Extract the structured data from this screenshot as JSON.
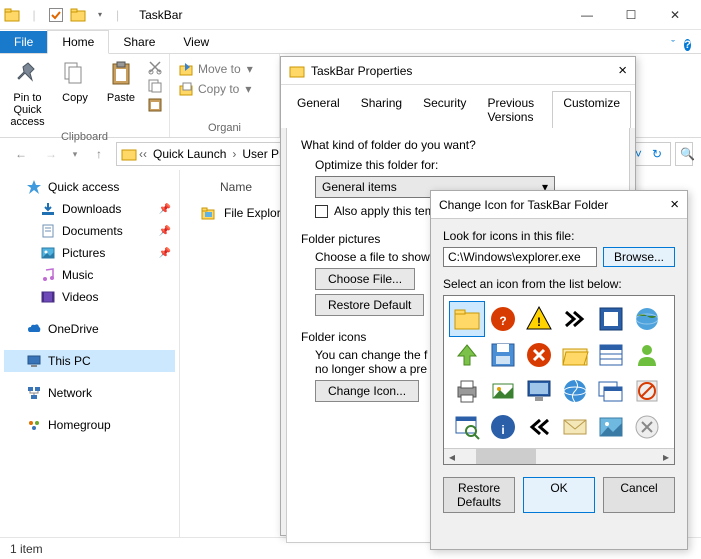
{
  "titlebar": {
    "title": "TaskBar"
  },
  "win_controls": {
    "min": "—",
    "max": "☐",
    "close": "✕"
  },
  "tabs": {
    "file": "File",
    "home": "Home",
    "share": "Share",
    "view": "View"
  },
  "ribbon": {
    "pin": "Pin to Quick\naccess",
    "copy": "Copy",
    "paste": "Paste",
    "clipboard_group": "Clipboard",
    "moveto": "Move to",
    "copyto": "Copy to",
    "organize_group": "Organi"
  },
  "breadcrumb": {
    "seg1": "Quick Launch",
    "seg2": "User Pi"
  },
  "nav": {
    "quick": "Quick access",
    "downloads": "Downloads",
    "documents": "Documents",
    "pictures": "Pictures",
    "music": "Music",
    "videos": "Videos",
    "onedrive": "OneDrive",
    "thispc": "This PC",
    "network": "Network",
    "homegroup": "Homegroup"
  },
  "content": {
    "header": "Name",
    "item1": "File Explorer"
  },
  "status": {
    "count": "1 item"
  },
  "props": {
    "title": "TaskBar Properties",
    "tabs": {
      "general": "General",
      "sharing": "Sharing",
      "security": "Security",
      "prev": "Previous Versions",
      "customize": "Customize"
    },
    "q1": "What kind of folder do you want?",
    "optimize": "Optimize this folder for:",
    "combo_val": "General items",
    "also_apply": "Also apply this tem",
    "pictures_sect": "Folder pictures",
    "choose_desc": "Choose a file to show",
    "choose_btn": "Choose File...",
    "restore_btn": "Restore Default",
    "icons_sect": "Folder icons",
    "icons_desc1": "You can change the f",
    "icons_desc2": "no longer show a pre",
    "change_icon": "Change Icon..."
  },
  "chicon": {
    "title": "Change Icon for TaskBar Folder",
    "look_label": "Look for icons in this file:",
    "path": "C:\\Windows\\explorer.exe",
    "browse": "Browse...",
    "select_label": "Select an icon from the list below:",
    "restore": "Restore Defaults",
    "ok": "OK",
    "cancel": "Cancel"
  }
}
